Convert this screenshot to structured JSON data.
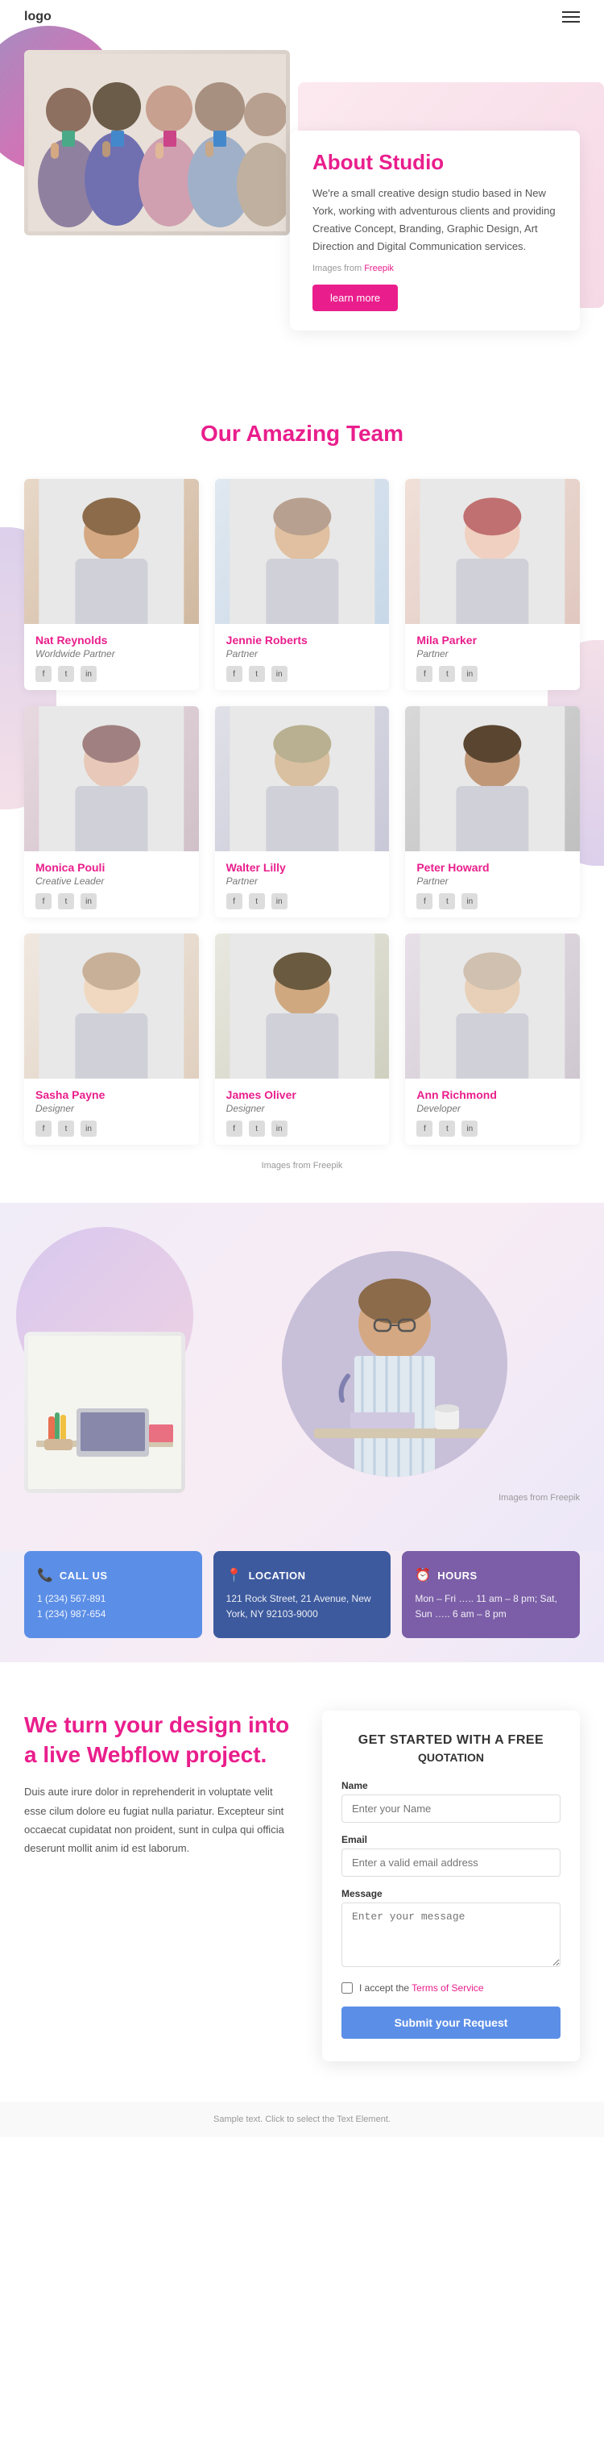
{
  "header": {
    "logo": "logo",
    "menu_icon": "☰"
  },
  "hero": {
    "about_title": "About Studio",
    "about_desc": "We're a small creative design studio based in New York, working with adventurous clients and providing Creative Concept, Branding, Graphic Design, Art Direction and Digital Communication services.",
    "images_from": "Images from",
    "freepik": "Freepik",
    "learn_more": "learn more"
  },
  "team": {
    "title": "Our Amazing Team",
    "members": [
      {
        "name": "Nat Reynolds",
        "role": "Worldwide Partner",
        "photo_class": "photo-1"
      },
      {
        "name": "Jennie Roberts",
        "role": "Partner",
        "photo_class": "photo-2"
      },
      {
        "name": "Mila Parker",
        "role": "Partner",
        "photo_class": "photo-3"
      },
      {
        "name": "Monica Pouli",
        "role": "Creative Leader",
        "photo_class": "photo-4"
      },
      {
        "name": "Walter Lilly",
        "role": "Partner",
        "photo_class": "photo-5"
      },
      {
        "name": "Peter Howard",
        "role": "Partner",
        "photo_class": "photo-6"
      },
      {
        "name": "Sasha Payne",
        "role": "Designer",
        "photo_class": "photo-7"
      },
      {
        "name": "James Oliver",
        "role": "Designer",
        "photo_class": "photo-8"
      },
      {
        "name": "Ann Richmond",
        "role": "Developer",
        "photo_class": "photo-9"
      }
    ],
    "images_source": "Images from Freepik"
  },
  "feature": {
    "images_source": "Images from Freepik"
  },
  "info_cards": [
    {
      "icon": "📞",
      "title": "CALL US",
      "lines": [
        "1 (234) 567-891",
        "1 (234) 987-654"
      ],
      "color_class": "blue"
    },
    {
      "icon": "📍",
      "title": "LOCATION",
      "lines": [
        "121 Rock Street, 21 Avenue, New York, NY 92103-9000"
      ],
      "color_class": "dark-blue"
    },
    {
      "icon": "⏰",
      "title": "HOURS",
      "lines": [
        "Mon – Fri ….. 11 am – 8 pm; Sat,",
        "Sun ….. 6 am – 8 pm"
      ],
      "color_class": "purple"
    }
  ],
  "bottom": {
    "left_title": "We turn your design into a live Webflow project.",
    "left_desc": "Duis aute irure dolor in reprehenderit in voluptate velit esse cilum dolore eu fugiat nulla pariatur. Excepteur sint occaecat cupidatat non proident, sunt in culpa qui officia deserunt mollit anim id est laborum."
  },
  "form": {
    "title": "GET STARTED WITH A FREE",
    "subtitle": "QUOTATION",
    "name_label": "Name",
    "name_placeholder": "Enter your Name",
    "email_label": "Email",
    "email_placeholder": "Enter a valid email address",
    "message_label": "Message",
    "message_placeholder": "Enter your message",
    "checkbox_text": "I accept the",
    "terms_link": "Terms of Service",
    "submit_label": "Submit your Request"
  },
  "footer": {
    "note": "Sample text. Click to select the Text Element."
  }
}
